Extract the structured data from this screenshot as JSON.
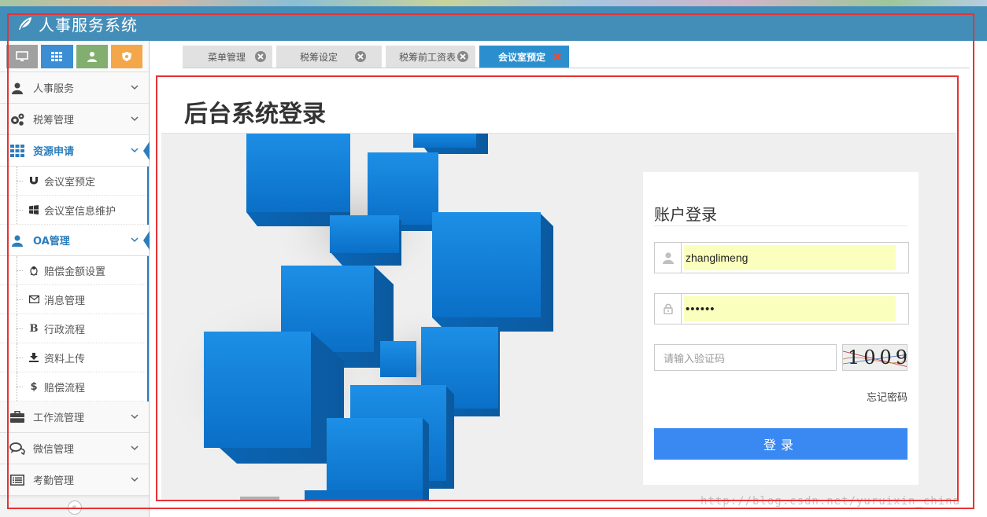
{
  "app": {
    "title": "人事服务系统"
  },
  "shortcuts": [
    {
      "name": "monitor",
      "color": "#a0a0a0"
    },
    {
      "name": "grid",
      "color": "#3b8dd4"
    },
    {
      "name": "user",
      "color": "#82af6f"
    },
    {
      "name": "badge",
      "color": "#f4a74a"
    }
  ],
  "sidebar": {
    "items": [
      {
        "label": "人事服务",
        "icon": "user-icon"
      },
      {
        "label": "税筹管理",
        "icon": "gears-icon"
      },
      {
        "label": "资源申请",
        "icon": "grid-icon",
        "active": true,
        "children": [
          {
            "label": "会议室预定",
            "icon": "magnet-icon"
          },
          {
            "label": "会议室信息维护",
            "icon": "windows-icon"
          }
        ]
      },
      {
        "label": "OA管理",
        "icon": "user-icon",
        "active": true,
        "children": [
          {
            "label": "赔偿金额设置",
            "icon": "linux-icon"
          },
          {
            "label": "消息管理",
            "icon": "envelope-icon"
          },
          {
            "label": "行政流程",
            "icon": "bold-icon",
            "glyph": "B"
          },
          {
            "label": "资料上传",
            "icon": "download-icon"
          },
          {
            "label": "赔偿流程",
            "icon": "dollar-icon",
            "glyph": "$"
          }
        ]
      },
      {
        "label": "工作流管理",
        "icon": "briefcase-icon"
      },
      {
        "label": "微信管理",
        "icon": "comments-icon"
      },
      {
        "label": "考勤管理",
        "icon": "list-alt-icon"
      }
    ]
  },
  "tabs": [
    {
      "label": "菜单管理",
      "active": false
    },
    {
      "label": "税筹设定",
      "active": false
    },
    {
      "label": "税筹前工资表",
      "active": false
    },
    {
      "label": "会议室预定",
      "active": true
    }
  ],
  "main": {
    "title": "后台系统登录"
  },
  "login": {
    "title": "账户登录",
    "username": "zhanglimeng",
    "password": "••••••",
    "captcha_placeholder": "请输入验证码",
    "captcha_text": "1009",
    "forgot_label": "忘记密码",
    "submit_label": "登录"
  },
  "watermark": "http://blog.csdn.net/yuruixin_china",
  "colors": {
    "header": "#438eb9",
    "active_blue": "#2b7dbc",
    "login_button": "#3a89f2",
    "autofill": "#faffbd",
    "annotation_red": "#e53333"
  }
}
